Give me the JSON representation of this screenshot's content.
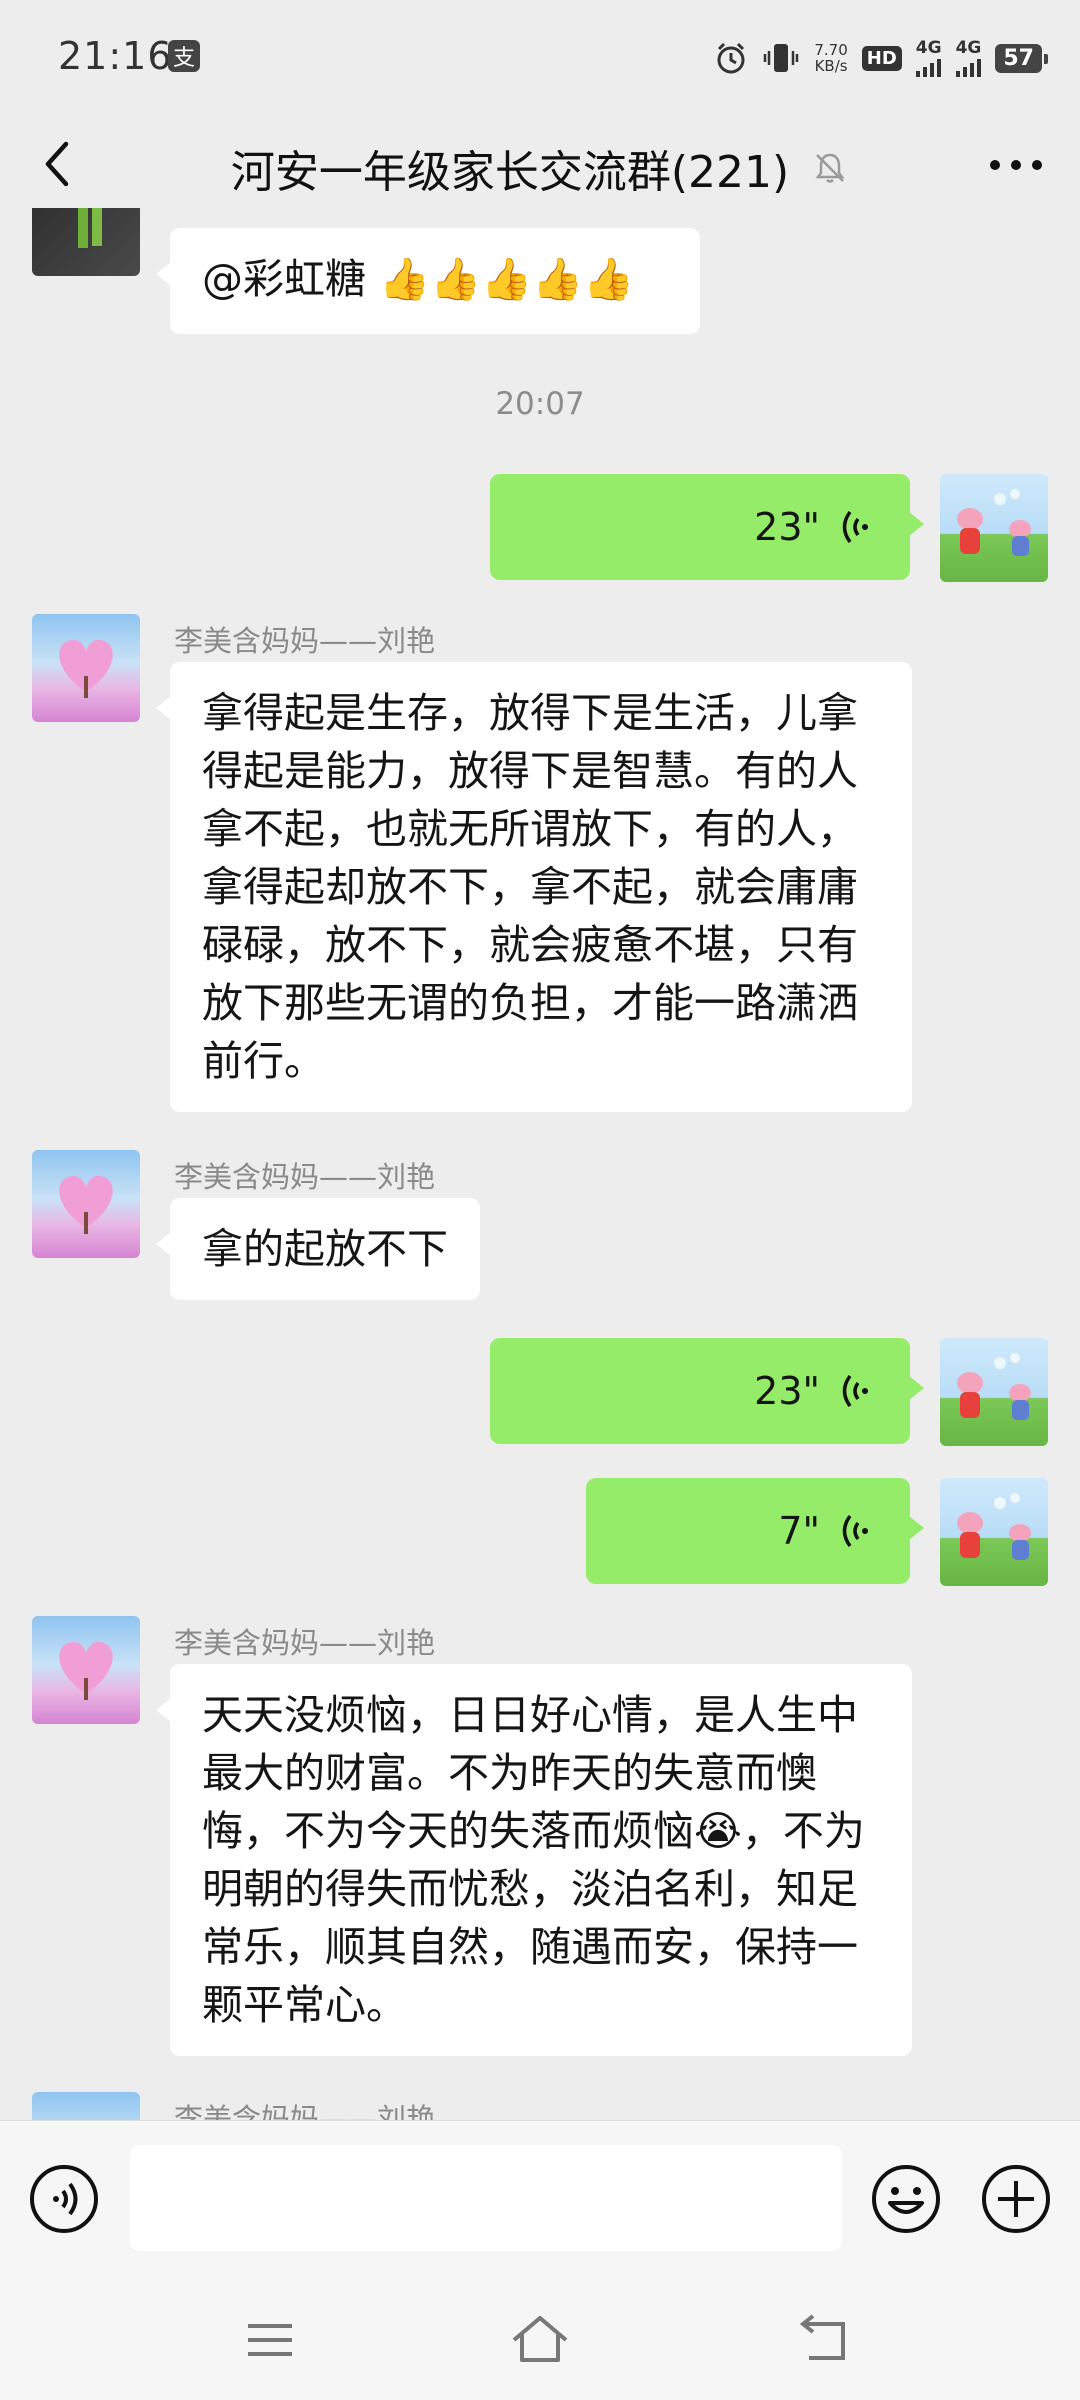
{
  "status_bar": {
    "time": "21:16",
    "alipay_glyph": "支",
    "net_speed_value": "7.70",
    "net_speed_unit": "KB/s",
    "hd_label": "HD",
    "sim1_label": "4G",
    "sim2_label": "4G",
    "battery": "57"
  },
  "header": {
    "title": "河安一年级家长交流群(221)"
  },
  "messages": {
    "m0": {
      "text": "@彩虹糖 👍👍👍👍👍"
    },
    "ts1": {
      "text": "20:07"
    },
    "v1": {
      "duration": "23\""
    },
    "m2": {
      "sender": "李美含妈妈——刘艳",
      "text": "拿得起是生存，放得下是生活，儿拿得起是能力，放得下是智慧。有的人拿不起，也就无所谓放下，有的人，拿得起却放不下，拿不起，就会庸庸碌碌，放不下，就会疲惫不堪，只有放下那些无谓的负担，才能一路潇洒前行。"
    },
    "m3": {
      "sender": "李美含妈妈——刘艳",
      "text": "拿的起放不下"
    },
    "v2": {
      "duration": "23\""
    },
    "v3": {
      "duration": "7\""
    },
    "m4": {
      "sender": "李美含妈妈——刘艳",
      "text": "天天没烦恼，日日好心情，是人生中最大的财富。不为昨天的失意而懊悔，不为今天的失落而烦恼😭，不为明朝的得失而忧愁，淡泊名利，知足常乐，顺其自然，随遇而安，保持一颗平常心。"
    },
    "m5": {
      "sender": "李美含妈妈——刘艳"
    }
  },
  "colors": {
    "background": "#ededed",
    "sent_bubble": "#95ec69",
    "received_bubble": "#ffffff"
  }
}
